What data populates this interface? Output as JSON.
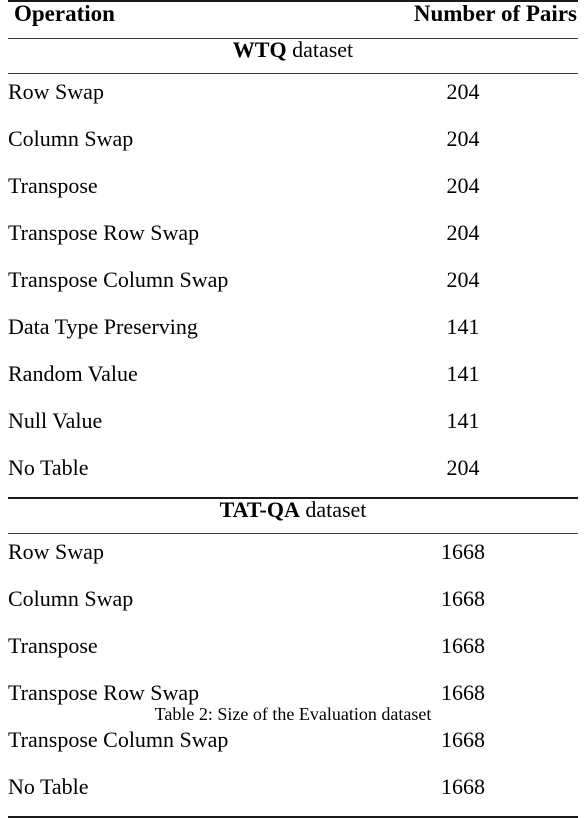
{
  "table": {
    "columns": [
      {
        "key": "operation",
        "label": "Operation",
        "align": "left"
      },
      {
        "key": "number_of_pairs",
        "label": "Number of Pairs",
        "align": "right"
      }
    ],
    "sections": [
      {
        "id": "wtq",
        "name": "WTQ",
        "suffix": " dataset",
        "rows": [
          {
            "operation": "Row Swap",
            "number_of_pairs": "204"
          },
          {
            "operation": "Column Swap",
            "number_of_pairs": "204"
          },
          {
            "operation": "Transpose",
            "number_of_pairs": "204"
          },
          {
            "operation": "Transpose Row Swap",
            "number_of_pairs": "204"
          },
          {
            "operation": "Transpose Column Swap",
            "number_of_pairs": "204"
          },
          {
            "operation": "Data Type Preserving",
            "number_of_pairs": "141"
          },
          {
            "operation": "Random Value",
            "number_of_pairs": "141"
          },
          {
            "operation": "Null Value",
            "number_of_pairs": "141"
          },
          {
            "operation": "No Table",
            "number_of_pairs": "204"
          }
        ]
      },
      {
        "id": "tatqa",
        "name": "TAT-QA",
        "suffix": " dataset",
        "rows": [
          {
            "operation": "Row Swap",
            "number_of_pairs": "1668"
          },
          {
            "operation": "Column Swap",
            "number_of_pairs": "1668"
          },
          {
            "operation": "Transpose",
            "number_of_pairs": "1668"
          },
          {
            "operation": "Transpose Row Swap",
            "number_of_pairs": "1668"
          },
          {
            "operation": "Transpose Column Swap",
            "number_of_pairs": "1668"
          },
          {
            "operation": "No Table",
            "number_of_pairs": "1668"
          }
        ]
      }
    ]
  },
  "caption": {
    "text": "Table 2: Size of the Evaluation dataset"
  }
}
